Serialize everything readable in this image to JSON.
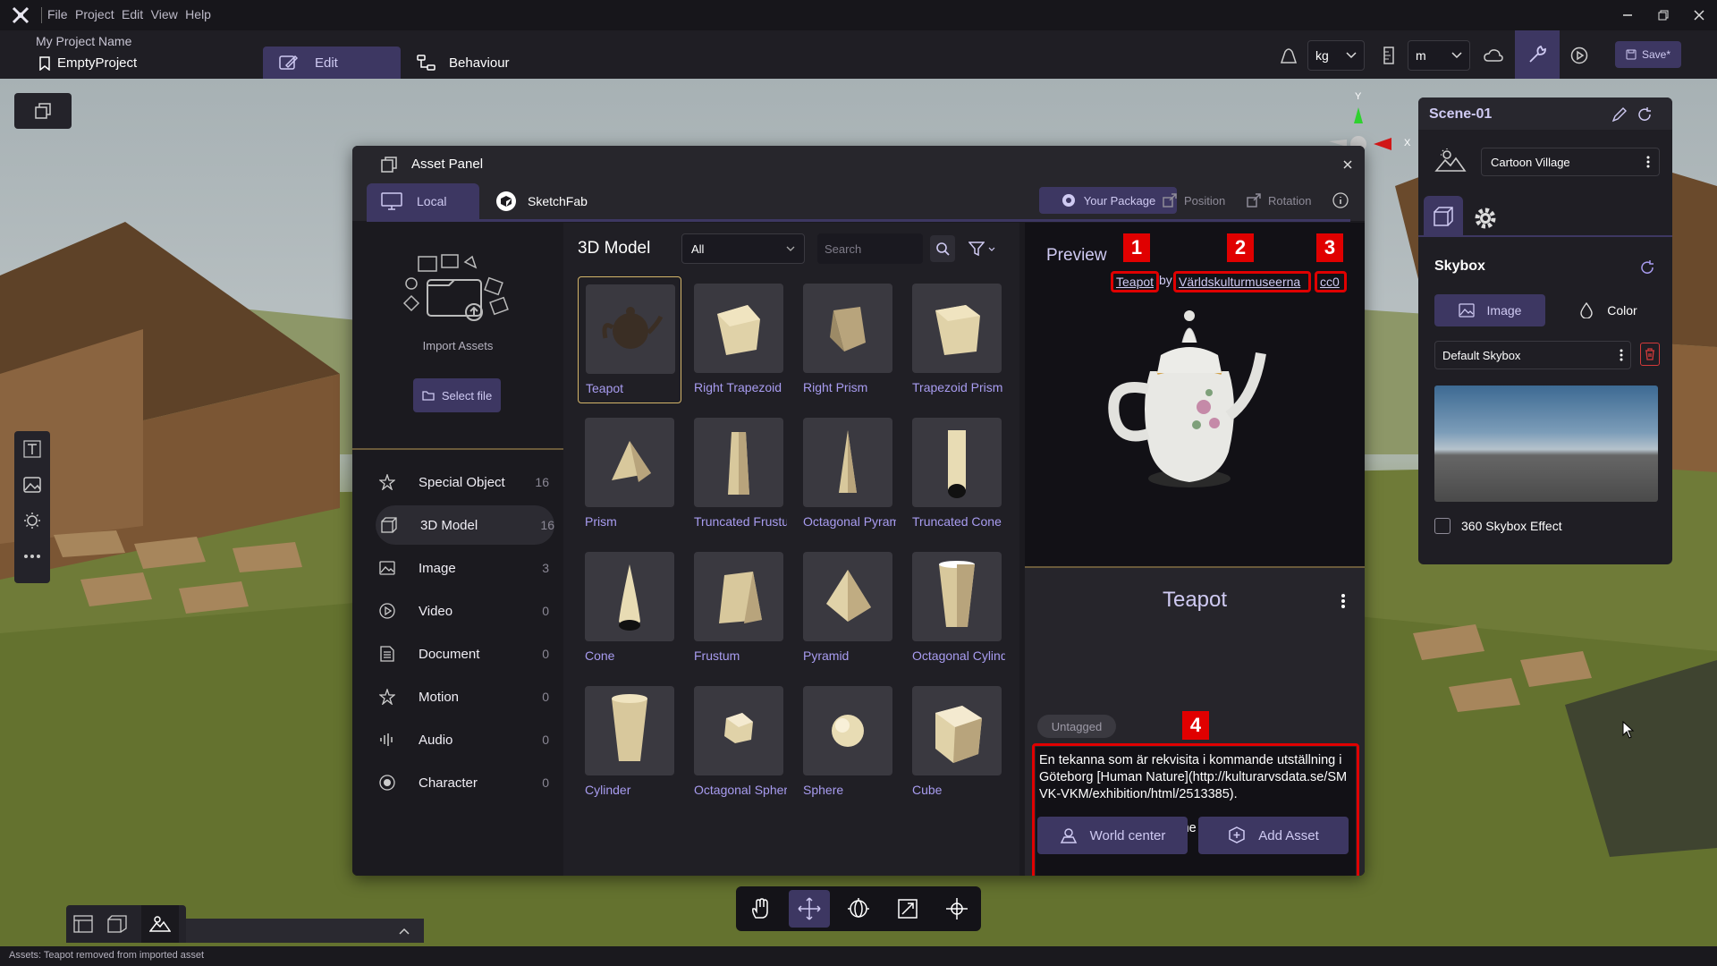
{
  "titlebar": {
    "menu": [
      "File",
      "Project",
      "Edit",
      "View",
      "Help"
    ]
  },
  "toolbar": {
    "project_name": "My Project Name",
    "file_name": "EmptyProject",
    "tab_edit": "Edit",
    "tab_behaviour": "Behaviour",
    "mass_unit": "kg",
    "length_unit": "m",
    "save_label": "Save*"
  },
  "gizmo": {
    "y": "Y",
    "x": "X"
  },
  "asset_panel": {
    "title": "Asset Panel",
    "tab_local": "Local",
    "tab_sketchfab": "SketchFab",
    "your_package": "Your Package",
    "position": "Position",
    "rotation": "Rotation",
    "import_label": "Import Assets",
    "select_file": "Select file",
    "categories": [
      {
        "name": "Special Object",
        "count": "16",
        "icon": "star-icon"
      },
      {
        "name": "3D Model",
        "count": "16",
        "icon": "cube-icon"
      },
      {
        "name": "Image",
        "count": "3",
        "icon": "image-icon"
      },
      {
        "name": "Video",
        "count": "0",
        "icon": "play-icon"
      },
      {
        "name": "Document",
        "count": "0",
        "icon": "document-icon"
      },
      {
        "name": "Motion",
        "count": "0",
        "icon": "motion-icon"
      },
      {
        "name": "Audio",
        "count": "0",
        "icon": "audio-icon"
      },
      {
        "name": "Character",
        "count": "0",
        "icon": "character-icon"
      }
    ],
    "grid_title": "3D Model",
    "filter_value": "All",
    "search_placeholder": "Search",
    "models": [
      "Teapot",
      "Right Trapezoid",
      "Right Prism",
      "Trapezoid Prism",
      "Prism",
      "Truncated Frustum",
      "Octagonal Pyramid",
      "Truncated Cone",
      "Cone",
      "Frustum",
      "Pyramid",
      "Octagonal Cylinder",
      "Cylinder",
      "Octagonal Sphere",
      "Sphere",
      "Cube"
    ],
    "preview": {
      "title": "Preview",
      "credit_name": "Teapot",
      "credit_by": "by",
      "credit_author": "Världskulturmuseerna",
      "credit_license": "cc0",
      "tag1": "1",
      "tag2": "2",
      "tag3": "3",
      "tag4": "4",
      "asset_name": "Teapot",
      "tag": "Untagged",
      "description": "En tekanna som är rekvisita i kommande utställning i Göteborg [Human Nature](http://kulturarvsdata.se/SMVK-VKM/exhibition/html/2513385).\n\nA teapot that is props in the upcoming exhibition in Gothenburg Human Nature.",
      "world_center": "World center",
      "add_asset": "Add Asset"
    }
  },
  "scene_panel": {
    "title": "Scene-01",
    "environment": "Cartoon Village",
    "skybox_title": "Skybox",
    "seg_image": "Image",
    "seg_color": "Color",
    "skybox_value": "Default Skybox",
    "effect_label": "360 Skybox Effect"
  },
  "statusbar": {
    "text": "Assets: Teapot removed from imported asset"
  },
  "colors": {
    "accent": "#3d3762",
    "accent_text": "#cfcaf2",
    "link": "#a89cf0",
    "highlight_red": "#e00000"
  }
}
